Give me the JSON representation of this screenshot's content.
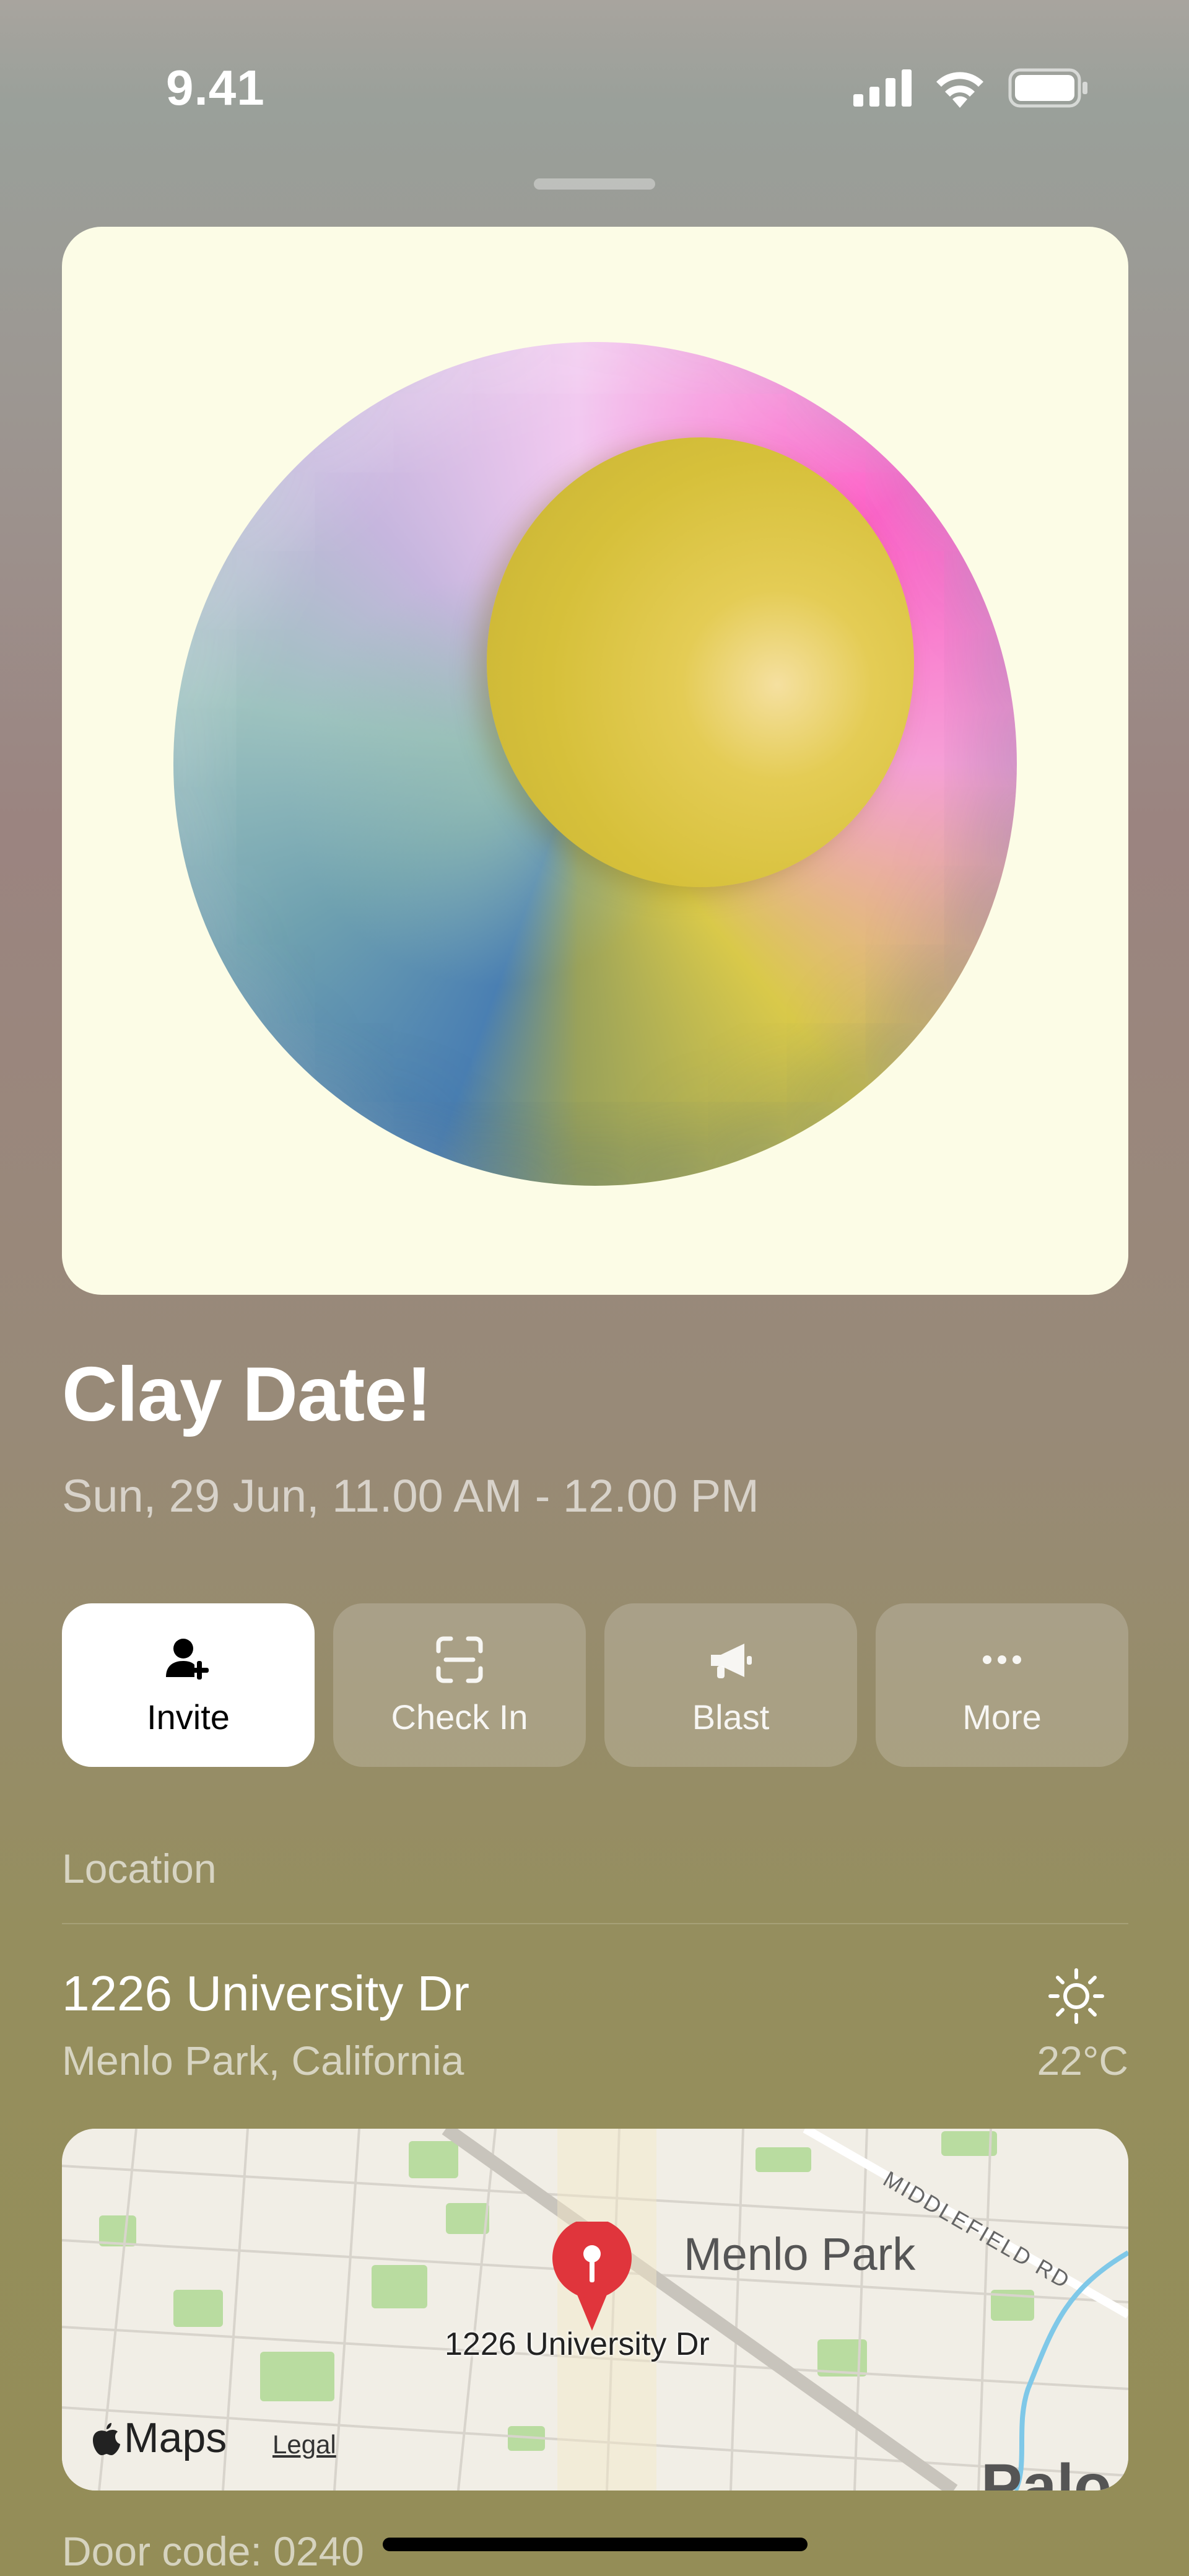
{
  "status_bar": {
    "time": "9.41",
    "icons": [
      "cellular-signal-icon",
      "wifi-icon",
      "battery-icon"
    ]
  },
  "event": {
    "title": "Clay Date!",
    "datetime": "Sun, 29 Jun, 11.00 AM - 12.00 PM"
  },
  "actions": [
    {
      "label": "Invite",
      "icon": "person-add-icon"
    },
    {
      "label": "Check In",
      "icon": "qr-scan-icon"
    },
    {
      "label": "Blast",
      "icon": "megaphone-icon"
    },
    {
      "label": "More",
      "icon": "ellipsis-icon"
    }
  ],
  "location": {
    "section_label": "Location",
    "address_line1": "1226 University Dr",
    "address_line2": "Menlo Park, California",
    "weather_icon": "sun-icon",
    "temperature": "22°C"
  },
  "map": {
    "city_label": "Menlo Park",
    "pin_label": "1226 University Dr",
    "road_label": "MIDDLEFIELD RD",
    "corner_text": "Palo",
    "brand": "Maps",
    "legal": "Legal"
  },
  "door_code": "Door code: 0240",
  "colors": {
    "primary_button_bg": "#ffffff",
    "card_bg": "#fcfce6",
    "pin": "#e0353c"
  }
}
